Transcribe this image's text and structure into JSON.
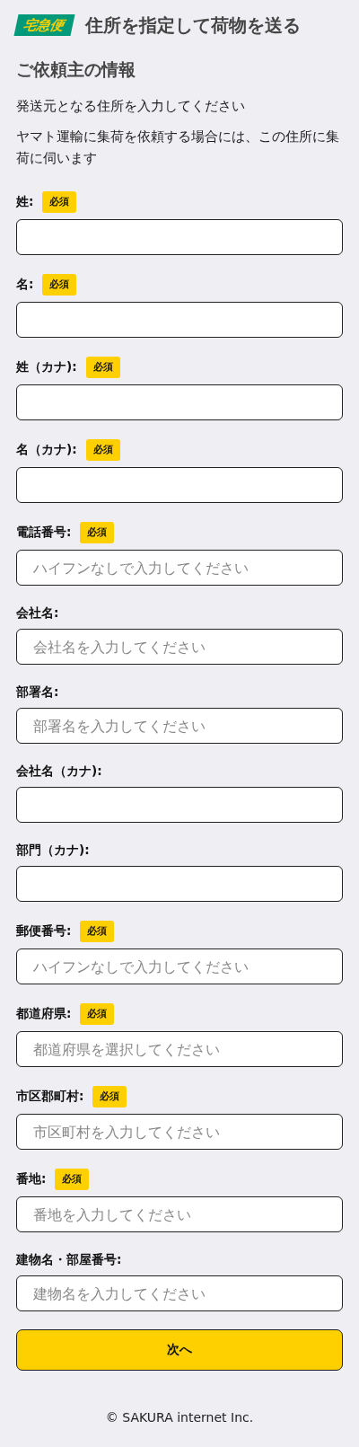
{
  "header": {
    "logo": "宅急便",
    "title": "住所を指定して荷物を送る"
  },
  "section_title": "ご依頼主の情報",
  "notes": [
    "発送元となる住所を入力してください",
    "ヤマト運輸に集荷を依頼する場合には、この住所に集荷に伺います"
  ],
  "fields": [
    {
      "label": "姓:",
      "required": true,
      "badge": "必須"
    },
    {
      "label": "名:",
      "required": true,
      "badge": "必須"
    },
    {
      "label": "姓（カナ):",
      "required": true,
      "badge": "必須"
    },
    {
      "label": "名（カナ):",
      "required": true,
      "badge": "必須"
    },
    {
      "label": "電話番号:",
      "required": true,
      "badge": "必須",
      "placeholder": "ハイフンなしで入力してください"
    },
    {
      "label": "会社名:",
      "required": false,
      "placeholder": "会社名を入力してください"
    },
    {
      "label": "部署名:",
      "required": false,
      "placeholder": "部署名を入力してください"
    },
    {
      "label": "会社名（カナ):",
      "required": false
    },
    {
      "label": "部門（カナ):",
      "required": false
    },
    {
      "label": "郵便番号:",
      "required": true,
      "badge": "必須",
      "placeholder": "ハイフンなしで入力してください"
    },
    {
      "label": "都道府県:",
      "required": true,
      "badge": "必須",
      "placeholder": "都道府県を選択してください"
    },
    {
      "label": "市区郡町村:",
      "required": true,
      "badge": "必須",
      "placeholder": "市区町村を入力してください"
    },
    {
      "label": "番地:",
      "required": true,
      "badge": "必須",
      "placeholder": "番地を入力してください"
    },
    {
      "label": "建物名・部屋番号:",
      "required": false,
      "placeholder": "建物名を入力してください"
    }
  ],
  "submit_button": "次へ",
  "footer": "© SAKURA internet Inc."
}
